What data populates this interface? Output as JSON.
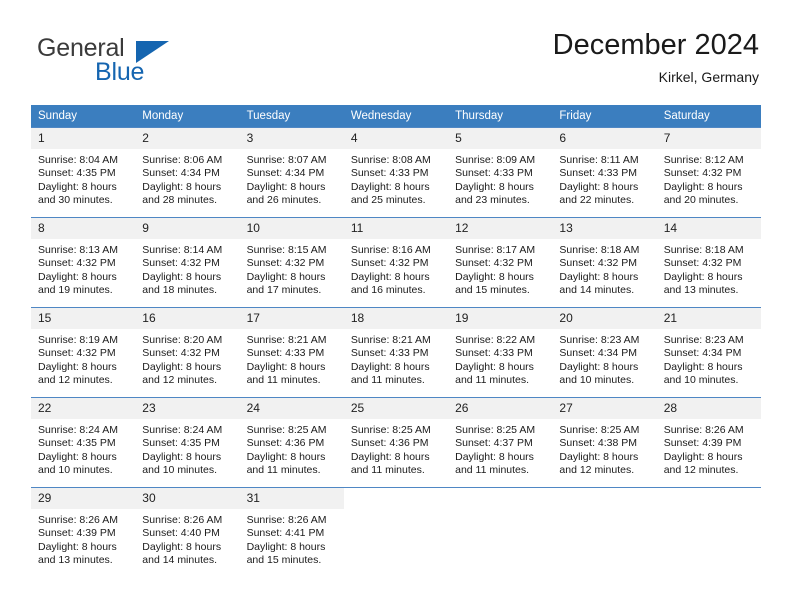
{
  "brand": {
    "name_part1": "General",
    "name_part2": "Blue",
    "triangle_color": "#1565b0"
  },
  "header": {
    "month_title": "December 2024",
    "location": "Kirkel, Germany"
  },
  "theme": {
    "header_row_bg": "#3b7ebf",
    "day_number_bg": "#f1f1f1",
    "text_color": "#1b1b1b"
  },
  "weekday_headers": [
    "Sunday",
    "Monday",
    "Tuesday",
    "Wednesday",
    "Thursday",
    "Friday",
    "Saturday"
  ],
  "weeks": [
    [
      {
        "day": "1",
        "sunrise": "Sunrise: 8:04 AM",
        "sunset": "Sunset: 4:35 PM",
        "daylight1": "Daylight: 8 hours",
        "daylight2": "and 30 minutes."
      },
      {
        "day": "2",
        "sunrise": "Sunrise: 8:06 AM",
        "sunset": "Sunset: 4:34 PM",
        "daylight1": "Daylight: 8 hours",
        "daylight2": "and 28 minutes."
      },
      {
        "day": "3",
        "sunrise": "Sunrise: 8:07 AM",
        "sunset": "Sunset: 4:34 PM",
        "daylight1": "Daylight: 8 hours",
        "daylight2": "and 26 minutes."
      },
      {
        "day": "4",
        "sunrise": "Sunrise: 8:08 AM",
        "sunset": "Sunset: 4:33 PM",
        "daylight1": "Daylight: 8 hours",
        "daylight2": "and 25 minutes."
      },
      {
        "day": "5",
        "sunrise": "Sunrise: 8:09 AM",
        "sunset": "Sunset: 4:33 PM",
        "daylight1": "Daylight: 8 hours",
        "daylight2": "and 23 minutes."
      },
      {
        "day": "6",
        "sunrise": "Sunrise: 8:11 AM",
        "sunset": "Sunset: 4:33 PM",
        "daylight1": "Daylight: 8 hours",
        "daylight2": "and 22 minutes."
      },
      {
        "day": "7",
        "sunrise": "Sunrise: 8:12 AM",
        "sunset": "Sunset: 4:32 PM",
        "daylight1": "Daylight: 8 hours",
        "daylight2": "and 20 minutes."
      }
    ],
    [
      {
        "day": "8",
        "sunrise": "Sunrise: 8:13 AM",
        "sunset": "Sunset: 4:32 PM",
        "daylight1": "Daylight: 8 hours",
        "daylight2": "and 19 minutes."
      },
      {
        "day": "9",
        "sunrise": "Sunrise: 8:14 AM",
        "sunset": "Sunset: 4:32 PM",
        "daylight1": "Daylight: 8 hours",
        "daylight2": "and 18 minutes."
      },
      {
        "day": "10",
        "sunrise": "Sunrise: 8:15 AM",
        "sunset": "Sunset: 4:32 PM",
        "daylight1": "Daylight: 8 hours",
        "daylight2": "and 17 minutes."
      },
      {
        "day": "11",
        "sunrise": "Sunrise: 8:16 AM",
        "sunset": "Sunset: 4:32 PM",
        "daylight1": "Daylight: 8 hours",
        "daylight2": "and 16 minutes."
      },
      {
        "day": "12",
        "sunrise": "Sunrise: 8:17 AM",
        "sunset": "Sunset: 4:32 PM",
        "daylight1": "Daylight: 8 hours",
        "daylight2": "and 15 minutes."
      },
      {
        "day": "13",
        "sunrise": "Sunrise: 8:18 AM",
        "sunset": "Sunset: 4:32 PM",
        "daylight1": "Daylight: 8 hours",
        "daylight2": "and 14 minutes."
      },
      {
        "day": "14",
        "sunrise": "Sunrise: 8:18 AM",
        "sunset": "Sunset: 4:32 PM",
        "daylight1": "Daylight: 8 hours",
        "daylight2": "and 13 minutes."
      }
    ],
    [
      {
        "day": "15",
        "sunrise": "Sunrise: 8:19 AM",
        "sunset": "Sunset: 4:32 PM",
        "daylight1": "Daylight: 8 hours",
        "daylight2": "and 12 minutes."
      },
      {
        "day": "16",
        "sunrise": "Sunrise: 8:20 AM",
        "sunset": "Sunset: 4:32 PM",
        "daylight1": "Daylight: 8 hours",
        "daylight2": "and 12 minutes."
      },
      {
        "day": "17",
        "sunrise": "Sunrise: 8:21 AM",
        "sunset": "Sunset: 4:33 PM",
        "daylight1": "Daylight: 8 hours",
        "daylight2": "and 11 minutes."
      },
      {
        "day": "18",
        "sunrise": "Sunrise: 8:21 AM",
        "sunset": "Sunset: 4:33 PM",
        "daylight1": "Daylight: 8 hours",
        "daylight2": "and 11 minutes."
      },
      {
        "day": "19",
        "sunrise": "Sunrise: 8:22 AM",
        "sunset": "Sunset: 4:33 PM",
        "daylight1": "Daylight: 8 hours",
        "daylight2": "and 11 minutes."
      },
      {
        "day": "20",
        "sunrise": "Sunrise: 8:23 AM",
        "sunset": "Sunset: 4:34 PM",
        "daylight1": "Daylight: 8 hours",
        "daylight2": "and 10 minutes."
      },
      {
        "day": "21",
        "sunrise": "Sunrise: 8:23 AM",
        "sunset": "Sunset: 4:34 PM",
        "daylight1": "Daylight: 8 hours",
        "daylight2": "and 10 minutes."
      }
    ],
    [
      {
        "day": "22",
        "sunrise": "Sunrise: 8:24 AM",
        "sunset": "Sunset: 4:35 PM",
        "daylight1": "Daylight: 8 hours",
        "daylight2": "and 10 minutes."
      },
      {
        "day": "23",
        "sunrise": "Sunrise: 8:24 AM",
        "sunset": "Sunset: 4:35 PM",
        "daylight1": "Daylight: 8 hours",
        "daylight2": "and 10 minutes."
      },
      {
        "day": "24",
        "sunrise": "Sunrise: 8:25 AM",
        "sunset": "Sunset: 4:36 PM",
        "daylight1": "Daylight: 8 hours",
        "daylight2": "and 11 minutes."
      },
      {
        "day": "25",
        "sunrise": "Sunrise: 8:25 AM",
        "sunset": "Sunset: 4:36 PM",
        "daylight1": "Daylight: 8 hours",
        "daylight2": "and 11 minutes."
      },
      {
        "day": "26",
        "sunrise": "Sunrise: 8:25 AM",
        "sunset": "Sunset: 4:37 PM",
        "daylight1": "Daylight: 8 hours",
        "daylight2": "and 11 minutes."
      },
      {
        "day": "27",
        "sunrise": "Sunrise: 8:25 AM",
        "sunset": "Sunset: 4:38 PM",
        "daylight1": "Daylight: 8 hours",
        "daylight2": "and 12 minutes."
      },
      {
        "day": "28",
        "sunrise": "Sunrise: 8:26 AM",
        "sunset": "Sunset: 4:39 PM",
        "daylight1": "Daylight: 8 hours",
        "daylight2": "and 12 minutes."
      }
    ],
    [
      {
        "day": "29",
        "sunrise": "Sunrise: 8:26 AM",
        "sunset": "Sunset: 4:39 PM",
        "daylight1": "Daylight: 8 hours",
        "daylight2": "and 13 minutes."
      },
      {
        "day": "30",
        "sunrise": "Sunrise: 8:26 AM",
        "sunset": "Sunset: 4:40 PM",
        "daylight1": "Daylight: 8 hours",
        "daylight2": "and 14 minutes."
      },
      {
        "day": "31",
        "sunrise": "Sunrise: 8:26 AM",
        "sunset": "Sunset: 4:41 PM",
        "daylight1": "Daylight: 8 hours",
        "daylight2": "and 15 minutes."
      },
      {
        "day": "",
        "sunrise": "",
        "sunset": "",
        "daylight1": "",
        "daylight2": ""
      },
      {
        "day": "",
        "sunrise": "",
        "sunset": "",
        "daylight1": "",
        "daylight2": ""
      },
      {
        "day": "",
        "sunrise": "",
        "sunset": "",
        "daylight1": "",
        "daylight2": ""
      },
      {
        "day": "",
        "sunrise": "",
        "sunset": "",
        "daylight1": "",
        "daylight2": ""
      }
    ]
  ]
}
